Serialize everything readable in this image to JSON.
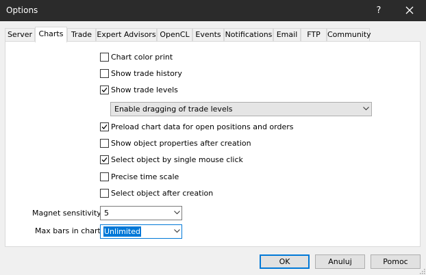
{
  "window": {
    "title": "Options",
    "help_label": "?"
  },
  "tabs": [
    {
      "label": "Server"
    },
    {
      "label": "Charts"
    },
    {
      "label": "Trade"
    },
    {
      "label": "Expert Advisors"
    },
    {
      "label": "OpenCL"
    },
    {
      "label": "Events"
    },
    {
      "label": "Notifications"
    },
    {
      "label": "Email"
    },
    {
      "label": "FTP"
    },
    {
      "label": "Community"
    }
  ],
  "active_tab": "Charts",
  "options": [
    {
      "label": "Chart color print",
      "checked": false
    },
    {
      "label": "Show trade history",
      "checked": false
    },
    {
      "label": "Show trade levels",
      "checked": true
    },
    {
      "label": "Preload chart data for open positions and orders",
      "checked": true
    },
    {
      "label": "Show object properties after creation",
      "checked": false
    },
    {
      "label": "Select object by single mouse click",
      "checked": true
    },
    {
      "label": "Precise time scale",
      "checked": false
    },
    {
      "label": "Select object after creation",
      "checked": false
    }
  ],
  "trade_levels_dropdown": {
    "value": "Enable dragging of trade levels"
  },
  "magnet": {
    "label": "Magnet sensitivity:",
    "value": "5"
  },
  "max_bars": {
    "label": "Max bars in chart:",
    "value": "Unlimited"
  },
  "buttons": {
    "ok": "OK",
    "cancel": "Anuluj",
    "help": "Pomoc"
  },
  "colors": {
    "titlebar": "#2b2b2b",
    "accent": "#0078d7",
    "panel": "#ffffff",
    "window_bg": "#f0f0f0"
  }
}
